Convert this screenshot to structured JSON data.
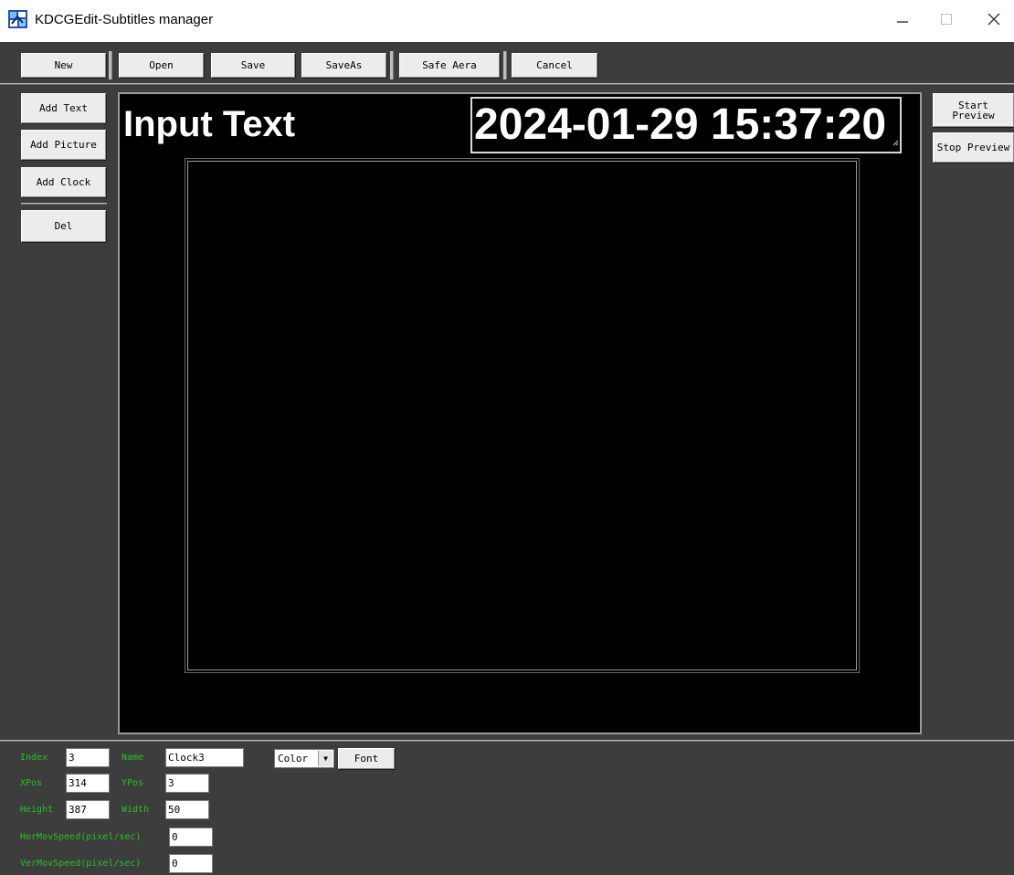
{
  "window": {
    "title": "KDCGEdit-Subtitles manager"
  },
  "toolbar": {
    "new": "New",
    "open": "Open",
    "save": "Save",
    "save_as": "SaveAs",
    "safe_area": "Safe Aera",
    "cancel": "Cancel"
  },
  "left_panel": {
    "add_text": "Add Text",
    "add_picture": "Add Picture",
    "add_clock": "Add Clock",
    "del": "Del"
  },
  "right_panel": {
    "start_preview_line1": "Start",
    "start_preview_line2": "Preview",
    "stop_preview": "Stop Preview"
  },
  "canvas": {
    "text_item": "Input Text",
    "clock_item": "2024-01-29 15:37:20"
  },
  "properties": {
    "index_label": "Index",
    "index_value": "3",
    "name_label": "Name",
    "name_value": "Clock3",
    "xpos_label": "XPos",
    "xpos_value": "314",
    "ypos_label": "YPos",
    "ypos_value": "3",
    "height_label": "Height",
    "height_value": "387",
    "width_label": "Width",
    "width_value": "50",
    "hor_speed_label": "HorMovSpeed(pixel/sec)",
    "hor_speed_value": "0",
    "ver_speed_label": "VerMovSpeed(pixel/sec)",
    "ver_speed_value": "0",
    "color_select": "Color",
    "font_button": "Font"
  },
  "colors": {
    "window_background": "#3d3d3d",
    "canvas_background": "#000000",
    "label_green": "#22c322",
    "button_face": "#ececec"
  }
}
